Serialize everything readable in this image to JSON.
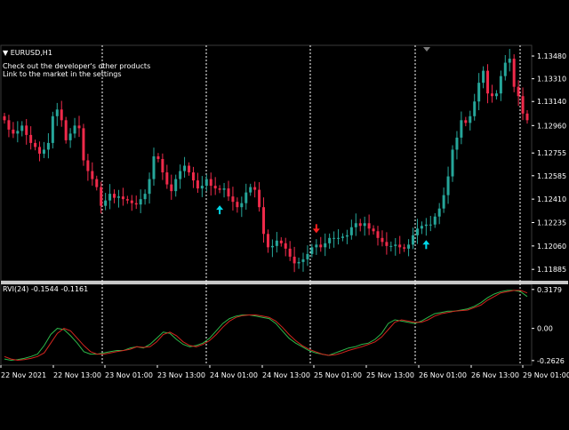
{
  "chart_data": [
    {
      "type": "candlestick",
      "symbol_title": "EURUSD,H1",
      "notes": [
        "Check out the developer's other products",
        "Link to the market in the settings"
      ],
      "y_ticks": [
        "1.13480",
        "1.13310",
        "1.13140",
        "1.12960",
        "1.12755",
        "1.12585",
        "1.12410",
        "1.12235",
        "1.12060",
        "1.11885"
      ],
      "ylim": [
        1.118,
        1.1356
      ],
      "x_ticks": [
        "22 Nov 2021",
        "22 Nov 13:00",
        "23 Nov 01:00",
        "23 Nov 13:00",
        "24 Nov 01:00",
        "24 Nov 13:00",
        "25 Nov 01:00",
        "25 Nov 13:00",
        "26 Nov 01:00",
        "26 Nov 13:00",
        "29 Nov 01:00"
      ],
      "close": [
        1.13,
        1.1293,
        1.129,
        1.1292,
        1.1296,
        1.1289,
        1.1283,
        1.128,
        1.1275,
        1.1278,
        1.1283,
        1.1303,
        1.1308,
        1.13,
        1.1285,
        1.129,
        1.1296,
        1.1294,
        1.127,
        1.1262,
        1.1256,
        1.125,
        1.1236,
        1.124,
        1.1245,
        1.1242,
        1.1243,
        1.1241,
        1.124,
        1.1238,
        1.1237,
        1.1241,
        1.1245,
        1.1256,
        1.1273,
        1.1271,
        1.1261,
        1.1252,
        1.1247,
        1.1256,
        1.1262,
        1.1266,
        1.1261,
        1.1255,
        1.1249,
        1.1251,
        1.1256,
        1.1251,
        1.1249,
        1.1248,
        1.1249,
        1.1243,
        1.1239,
        1.1235,
        1.1238,
        1.1246,
        1.125,
        1.1248,
        1.1235,
        1.1215,
        1.1205,
        1.1206,
        1.121,
        1.1208,
        1.1204,
        1.1198,
        1.1193,
        1.1194,
        1.1196,
        1.12,
        1.1205,
        1.1207,
        1.1205,
        1.1208,
        1.1212,
        1.1212,
        1.1212,
        1.1213,
        1.1214,
        1.122,
        1.1223,
        1.1221,
        1.1223,
        1.1219,
        1.1217,
        1.1212,
        1.1209,
        1.1206,
        1.1206,
        1.1207,
        1.1205,
        1.1204,
        1.1207,
        1.1214,
        1.1219,
        1.1221,
        1.1222,
        1.1222,
        1.1228,
        1.1234,
        1.1244,
        1.1258,
        1.1278,
        1.1287,
        1.13,
        1.1298,
        1.1303,
        1.1314,
        1.1328,
        1.1337,
        1.132,
        1.1318,
        1.132,
        1.1333,
        1.1343,
        1.1346,
        1.1325,
        1.1318,
        1.1305,
        1.13
      ],
      "indicator": {
        "title": "RVI(24) -0.1544 -0.1161",
        "y_ticks": [
          "0.3179",
          "0.00",
          "-0.2626"
        ],
        "ylim": [
          -0.3,
          0.36
        ],
        "series": [
          {
            "name": "",
            "color": "#2db84a",
            "values": [
              -0.25,
              -0.26,
              -0.255,
              -0.245,
              -0.23,
              -0.21,
              -0.14,
              -0.05,
              0.0,
              -0.01,
              -0.06,
              -0.12,
              -0.19,
              -0.21,
              -0.21,
              -0.2,
              -0.19,
              -0.18,
              -0.18,
              -0.16,
              -0.15,
              -0.16,
              -0.13,
              -0.08,
              -0.03,
              -0.04,
              -0.09,
              -0.13,
              -0.15,
              -0.14,
              -0.12,
              -0.08,
              -0.02,
              0.04,
              0.08,
              0.1,
              0.11,
              0.11,
              0.1,
              0.09,
              0.08,
              0.04,
              -0.02,
              -0.08,
              -0.12,
              -0.15,
              -0.18,
              -0.2,
              -0.21,
              -0.22,
              -0.2,
              -0.18,
              -0.16,
              -0.15,
              -0.13,
              -0.12,
              -0.09,
              -0.04,
              0.04,
              0.07,
              0.06,
              0.05,
              0.04,
              0.06,
              0.09,
              0.12,
              0.13,
              0.14,
              0.14,
              0.15,
              0.16,
              0.18,
              0.21,
              0.25,
              0.28,
              0.3,
              0.31,
              0.31,
              0.3,
              0.26
            ]
          },
          {
            "name": "",
            "color": "#d2261f",
            "values": [
              -0.23,
              -0.25,
              -0.26,
              -0.255,
              -0.245,
              -0.23,
              -0.2,
              -0.12,
              -0.04,
              0.0,
              -0.02,
              -0.08,
              -0.14,
              -0.19,
              -0.21,
              -0.21,
              -0.2,
              -0.19,
              -0.18,
              -0.17,
              -0.15,
              -0.155,
              -0.15,
              -0.11,
              -0.05,
              -0.03,
              -0.06,
              -0.11,
              -0.14,
              -0.15,
              -0.13,
              -0.1,
              -0.05,
              0.01,
              0.06,
              0.09,
              0.105,
              0.11,
              0.11,
              0.1,
              0.09,
              0.06,
              0.01,
              -0.05,
              -0.1,
              -0.14,
              -0.17,
              -0.19,
              -0.21,
              -0.22,
              -0.215,
              -0.2,
              -0.18,
              -0.165,
              -0.15,
              -0.13,
              -0.11,
              -0.07,
              -0.01,
              0.05,
              0.07,
              0.06,
              0.05,
              0.05,
              0.07,
              0.1,
              0.12,
              0.13,
              0.14,
              0.145,
              0.15,
              0.17,
              0.19,
              0.23,
              0.26,
              0.29,
              0.3,
              0.31,
              0.31,
              0.29
            ]
          }
        ]
      },
      "arrows": [
        {
          "type": "buy",
          "color": "#00d8e8",
          "bar": 49
        },
        {
          "type": "sell",
          "color": "#ff2020",
          "bar": 71
        },
        {
          "type": "buy",
          "color": "#00d8e8",
          "bar": 96
        }
      ],
      "colors": {
        "bull": "#26a69a",
        "bear": "#ef2a4a",
        "grid_separator": "#ffffff",
        "background": "#000000"
      }
    }
  ]
}
